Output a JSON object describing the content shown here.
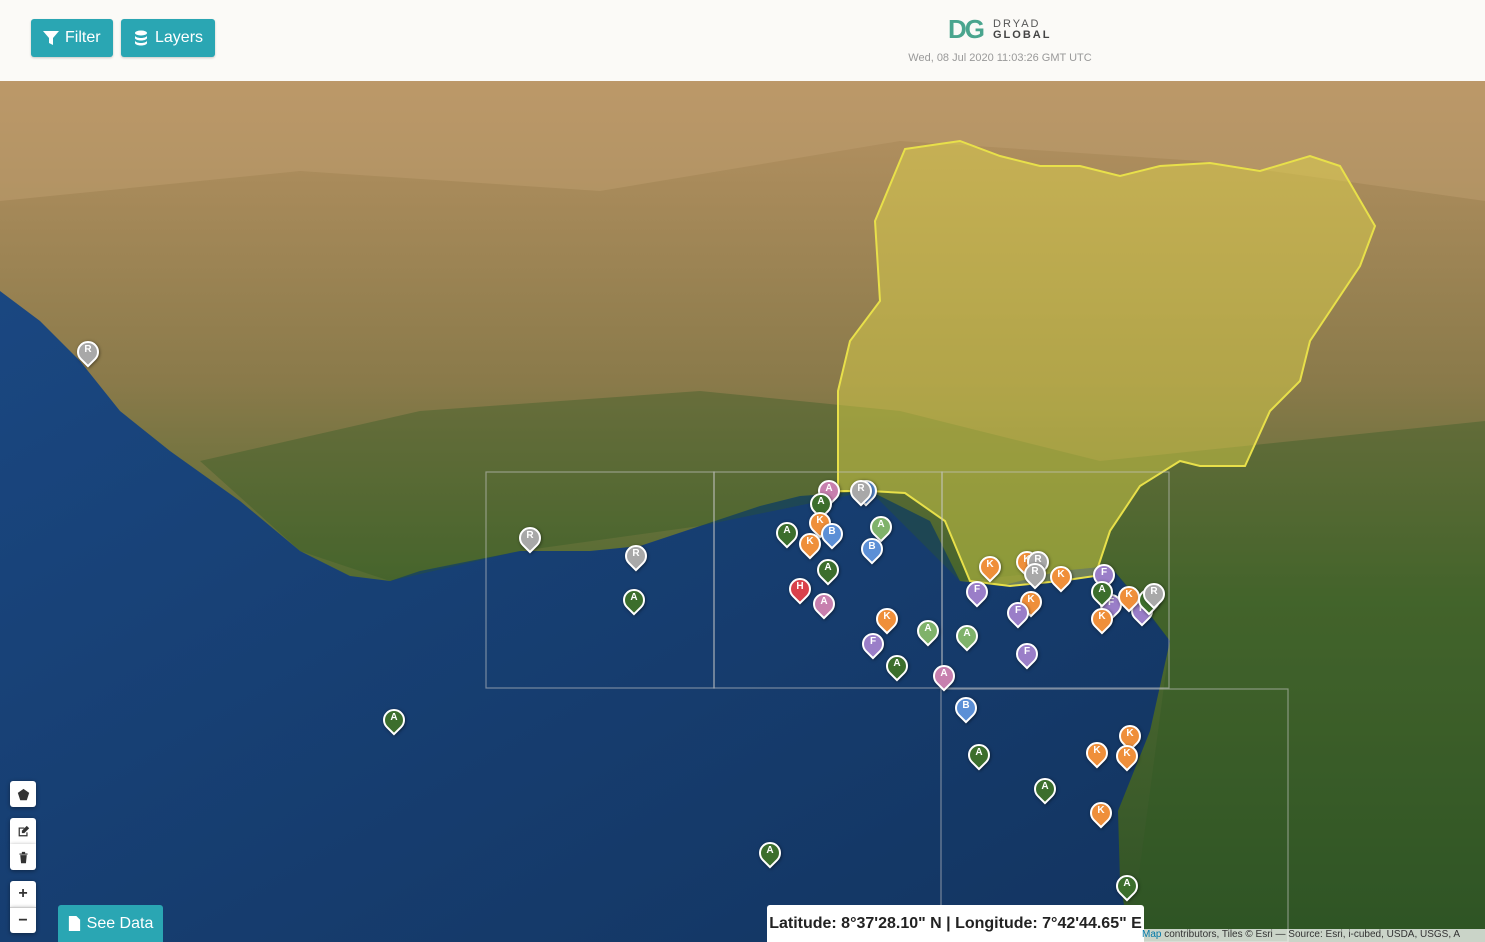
{
  "header": {
    "filter_label": "Filter",
    "layers_label": "Layers",
    "logo_mark": "DG",
    "logo_line1": "DRYAD",
    "logo_line2": "GLOBAL",
    "timestamp": "Wed, 08 Jul 2020 11:03:26 GMT UTC"
  },
  "footer": {
    "see_data_label": "See Data",
    "coordinates": "Latitude: 8°37'28.10\" N | Longitude: 7°42'44.65\" E",
    "attribution_link": "Map",
    "attribution_rest": " contributors, Tiles © Esri — Source: Esri, i-cubed, USDA, USGS, A"
  },
  "controls": {
    "draw_polygon": "polygon-icon",
    "edit": "edit-icon",
    "delete": "trash-icon",
    "zoom_in": "+",
    "zoom_out": "−"
  },
  "colors": {
    "A_dark": "#3c6e2c",
    "A_light": "#7fb26a",
    "A_pink": "#c77fae",
    "B": "#5b8fd6",
    "K": "#ef8f3a",
    "F": "#9a7ec8",
    "R": "#a8a8a8",
    "H": "#d9414b",
    "highlight_country": "#e2d94a",
    "accent": "#2aa6b3"
  },
  "markers": [
    {
      "label": "R",
      "color": "R"
    },
    {
      "label": "R",
      "color": "R"
    },
    {
      "label": "R",
      "color": "R"
    },
    {
      "label": "A",
      "color": "A_dark"
    },
    {
      "label": "A",
      "color": "A_dark"
    },
    {
      "label": "A",
      "color": "A_pink"
    },
    {
      "label": "B",
      "color": "B"
    },
    {
      "label": "R",
      "color": "R"
    },
    {
      "label": "A",
      "color": "A_dark"
    },
    {
      "label": "K",
      "color": "K"
    },
    {
      "label": "B",
      "color": "B"
    },
    {
      "label": "K",
      "color": "K"
    },
    {
      "label": "A",
      "color": "A_dark"
    },
    {
      "label": "A",
      "color": "A_light"
    },
    {
      "label": "B",
      "color": "B"
    },
    {
      "label": "A",
      "color": "A_dark"
    },
    {
      "label": "H",
      "color": "H"
    },
    {
      "label": "A",
      "color": "A_pink"
    },
    {
      "label": "K",
      "color": "K"
    },
    {
      "label": "F",
      "color": "F"
    },
    {
      "label": "A",
      "color": "A_light"
    },
    {
      "label": "A",
      "color": "A_dark"
    },
    {
      "label": "A",
      "color": "A_light"
    },
    {
      "label": "A",
      "color": "A_pink"
    },
    {
      "label": "K",
      "color": "K"
    },
    {
      "label": "F",
      "color": "F"
    },
    {
      "label": "K",
      "color": "K"
    },
    {
      "label": "R",
      "color": "R"
    },
    {
      "label": "R",
      "color": "R"
    },
    {
      "label": "K",
      "color": "K"
    },
    {
      "label": "K",
      "color": "K"
    },
    {
      "label": "F",
      "color": "F"
    },
    {
      "label": "F",
      "color": "F"
    },
    {
      "label": "F",
      "color": "F"
    },
    {
      "label": "A",
      "color": "A_dark"
    },
    {
      "label": "F",
      "color": "F"
    },
    {
      "label": "K",
      "color": "K"
    },
    {
      "label": "K",
      "color": "K"
    },
    {
      "label": "A",
      "color": "A_dark"
    },
    {
      "label": "R",
      "color": "R"
    },
    {
      "label": "F",
      "color": "F"
    },
    {
      "label": "B",
      "color": "B"
    },
    {
      "label": "A",
      "color": "A_dark"
    },
    {
      "label": "K",
      "color": "K"
    },
    {
      "label": "K",
      "color": "K"
    },
    {
      "label": "K",
      "color": "K"
    },
    {
      "label": "A",
      "color": "A_dark"
    },
    {
      "label": "K",
      "color": "K"
    },
    {
      "label": "A",
      "color": "A_dark"
    },
    {
      "label": "A",
      "color": "A_dark"
    }
  ]
}
